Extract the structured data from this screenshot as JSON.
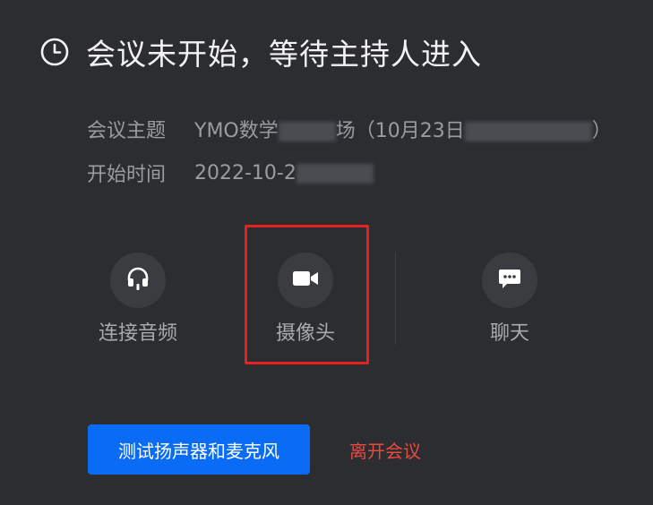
{
  "header": {
    "title": "会议未开始，等待主持人进入",
    "icon": "clock-icon"
  },
  "meeting_info": {
    "topic_label": "会议主题",
    "topic_value_start": "YMO数学",
    "topic_value_mid": "场（10月23日",
    "topic_value_end": "）",
    "start_label": "开始时间",
    "start_value": "2022-10-2"
  },
  "controls": {
    "audio": {
      "label": "连接音频",
      "icon": "headset-icon"
    },
    "camera": {
      "label": "摄像头",
      "icon": "video-camera-icon"
    },
    "chat": {
      "label": "聊天",
      "icon": "chat-bubble-icon"
    }
  },
  "actions": {
    "test_label": "测试扬声器和麦克风",
    "leave_label": "离开会议"
  },
  "colors": {
    "background": "#2b2d30",
    "primary": "#0a6cf5",
    "danger": "#e84a41",
    "highlight": "#e8211e"
  }
}
